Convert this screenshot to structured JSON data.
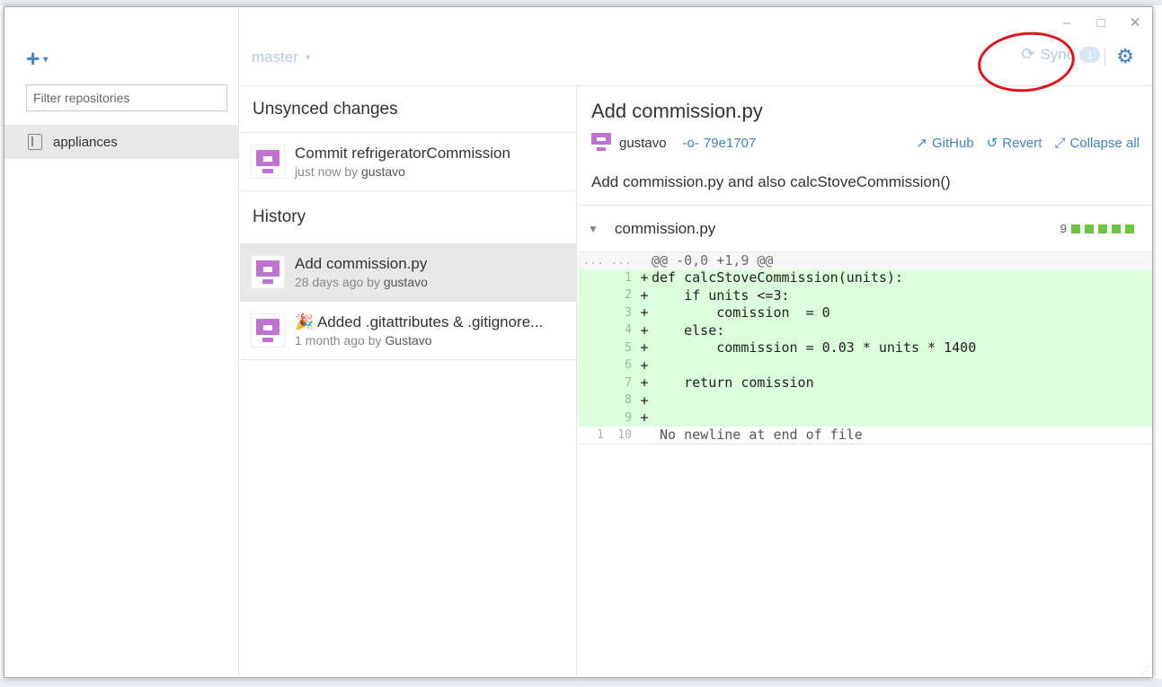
{
  "window": {
    "minimize_glyph": "–",
    "maximize_glyph": "□",
    "close_glyph": "✕"
  },
  "sidebar": {
    "add_glyph": "+",
    "add_caret": "▾",
    "filter_placeholder": "Filter repositories",
    "repos": [
      {
        "name": "appliances",
        "icon": "repo-icon"
      }
    ]
  },
  "toolbar": {
    "branch": "master",
    "branch_caret": "▾",
    "sync_icon": "⟳",
    "sync_label": "Sync",
    "sync_badge": "1",
    "settings_icon": "⚙"
  },
  "unsynced": {
    "title": "Unsynced changes",
    "commits": [
      {
        "title": "Commit refrigeratorCommission",
        "when": "just now by",
        "author": "gustavo"
      }
    ]
  },
  "history": {
    "title": "History",
    "commits": [
      {
        "title": "Add commission.py",
        "when": "28 days ago by",
        "author": "gustavo"
      },
      {
        "emoji": "🎉",
        "title": "Added .gitattributes & .gitignore...",
        "when": "1 month ago by",
        "author": "Gustavo"
      }
    ]
  },
  "detail": {
    "title": "Add commission.py",
    "author": "gustavo",
    "sha_icon": "-o-",
    "sha": "79e1707",
    "actions": {
      "github": "GitHub",
      "github_icon": "↗",
      "revert": "Revert",
      "revert_icon": "↺",
      "collapse": "Collapse all",
      "collapse_icon": "⤢"
    },
    "description": "Add commission.py and also calcStoveCommission()",
    "file": {
      "caret": "▼",
      "name": "commission.py",
      "changes": "9"
    },
    "diff": {
      "hunk": {
        "old": "...",
        "new": "...",
        "text": "@@ -0,0 +1,9 @@"
      },
      "lines": [
        {
          "new": "1",
          "sign": "+",
          "text": "def calcStoveCommission(units):"
        },
        {
          "new": "2",
          "sign": "+",
          "text": "    if units <=3:"
        },
        {
          "new": "3",
          "sign": "+",
          "text": "        comission  = 0"
        },
        {
          "new": "4",
          "sign": "+",
          "text": "    else:"
        },
        {
          "new": "5",
          "sign": "+",
          "text": "        commission = 0.03 * units * 1400"
        },
        {
          "new": "6",
          "sign": "+",
          "text": ""
        },
        {
          "new": "7",
          "sign": "+",
          "text": "    return comission"
        },
        {
          "new": "8",
          "sign": "+",
          "text": ""
        },
        {
          "new": "9",
          "sign": "+",
          "text": ""
        }
      ],
      "footer": {
        "old": "1",
        "new": "10",
        "text": " No newline at end of file"
      }
    }
  }
}
